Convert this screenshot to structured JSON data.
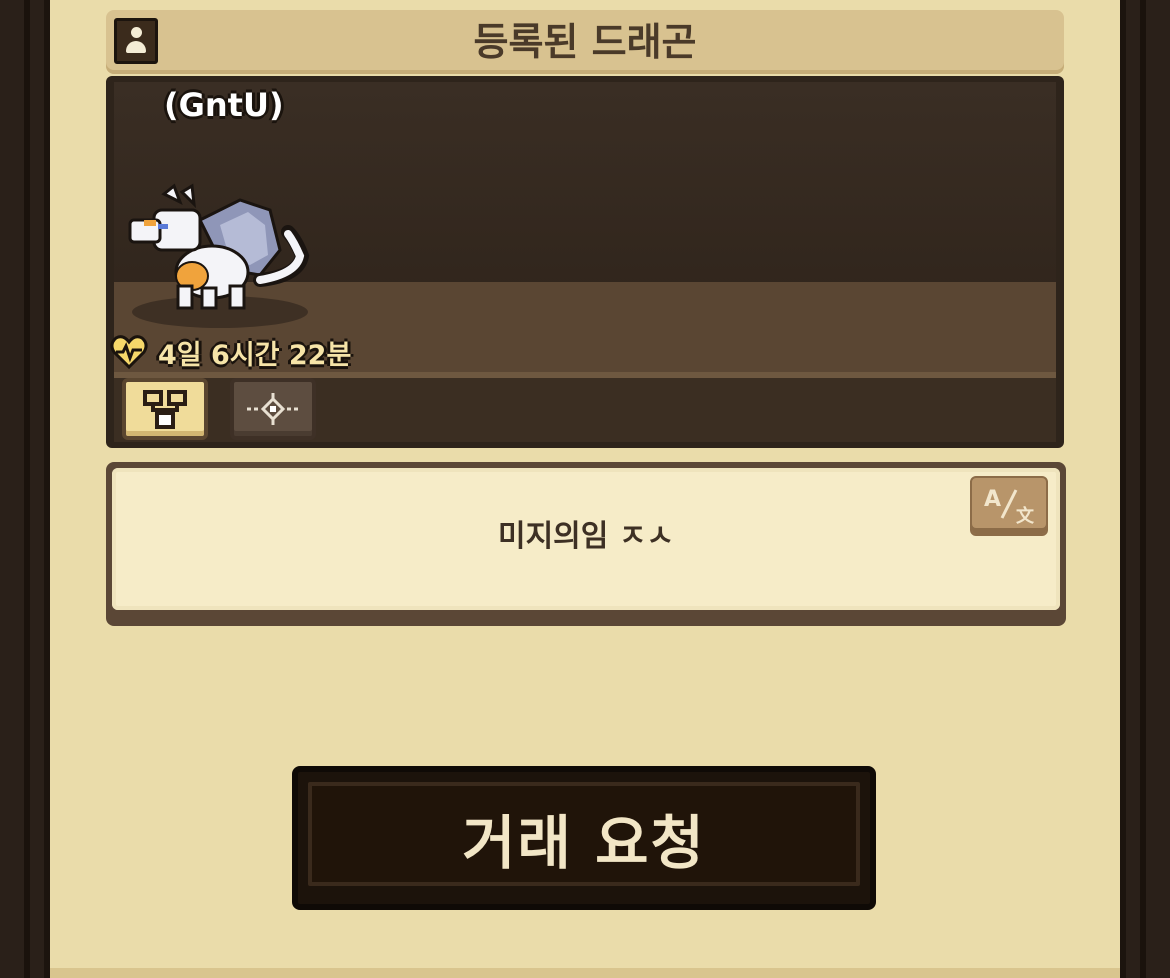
{
  "header": {
    "title": "등록된 드래곤",
    "icon": "profile-icon"
  },
  "dragon_display": {
    "owner_name": "(GntU)",
    "timer_icon": "heart-pulse-icon",
    "timer_text": "4일 6시간 22분",
    "tabs": [
      {
        "icon": "family-tree-icon",
        "active": true
      },
      {
        "icon": "target-icon",
        "active": false
      }
    ]
  },
  "message": {
    "text": "미지의임 ㅈㅅ",
    "translate_icon": "translate-icon"
  },
  "trade_button": {
    "label": "거래 요청"
  },
  "colors": {
    "panel_bg": "#eadcaa",
    "header_bg": "#d8c290",
    "display_bg": "#2e241b",
    "button_bg": "#1c130b",
    "accent_yellow": "#f0dc9a"
  }
}
